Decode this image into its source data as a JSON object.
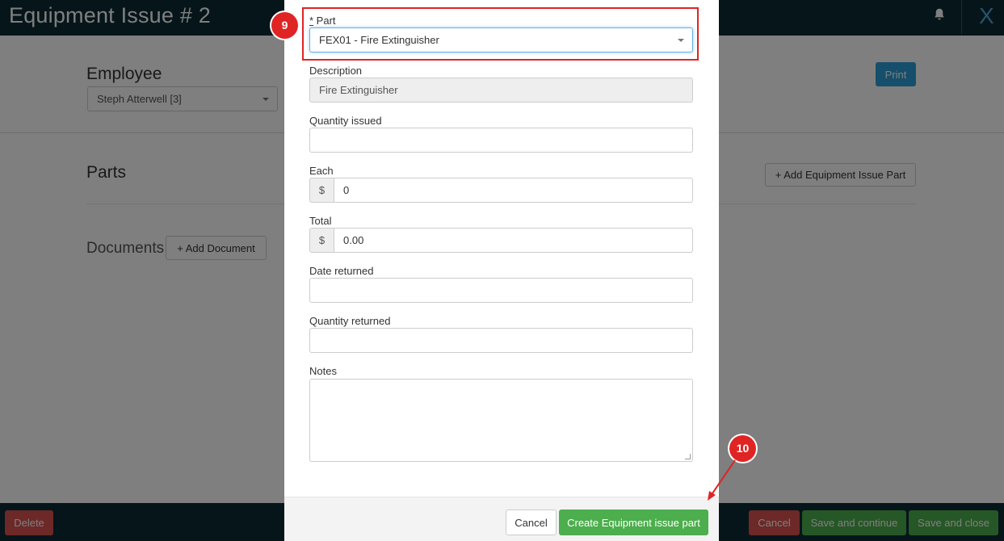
{
  "header": {
    "title": "Equipment Issue # 2",
    "close_label": "X",
    "bell_icon": "bell-icon"
  },
  "form": {
    "employee_label": "Employee",
    "employee_value": "Steph Atterwell [3]",
    "print_label": "Print",
    "parts_title": "Parts",
    "add_part_label": "+  Add Equipment Issue Part",
    "documents_title": "Documents",
    "add_document_label": "+  Add Document"
  },
  "footer": {
    "delete_label": "Delete",
    "cancel_label": "Cancel",
    "save_continue_label": "Save and continue",
    "save_close_label": "Save and close"
  },
  "modal": {
    "part_required": "*",
    "part_label": " Part",
    "part_value": "FEX01 - Fire Extinguisher",
    "description_label": "Description",
    "description_value": "Fire Extinguisher",
    "quantity_issued_label": "Quantity issued",
    "quantity_issued_value": "",
    "each_label": "Each",
    "each_currency": "$",
    "each_value": "0",
    "total_label": "Total",
    "total_currency": "$",
    "total_value": "0.00",
    "date_returned_label": "Date returned",
    "date_returned_value": "",
    "quantity_returned_label": "Quantity returned",
    "quantity_returned_value": "",
    "notes_label": "Notes",
    "cancel_label": "Cancel",
    "create_label": "Create Equipment issue part"
  },
  "annotations": {
    "step_a": "9",
    "step_b": "10",
    "color": "#e02424"
  }
}
